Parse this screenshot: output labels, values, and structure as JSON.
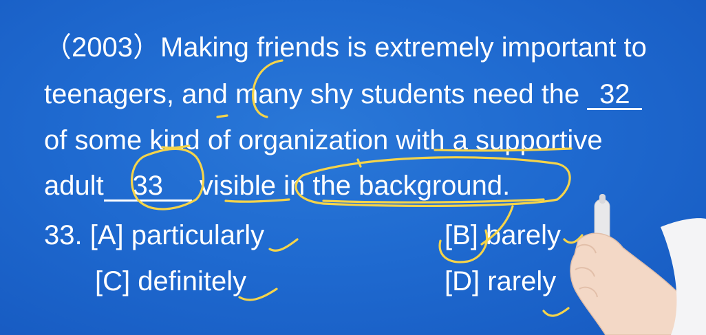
{
  "passage": {
    "line1": "（2003）Making friends is extremely important to",
    "line2_a": "teenagers, and many shy students need the ",
    "line2_blank": "32",
    "line3": "of some kind of organization with a supportive",
    "line4_a": "adult",
    "line4_blank": "33",
    "line4_b": " visible in the background."
  },
  "question": {
    "number": "33.",
    "option_a": "[A] particularly",
    "option_b": "[B] barely",
    "option_c": "[C] definitely",
    "option_d": "[D] rarely"
  },
  "colors": {
    "background": "#1f6ad0",
    "text": "#ffffff",
    "annotation": "#f5d44a"
  }
}
